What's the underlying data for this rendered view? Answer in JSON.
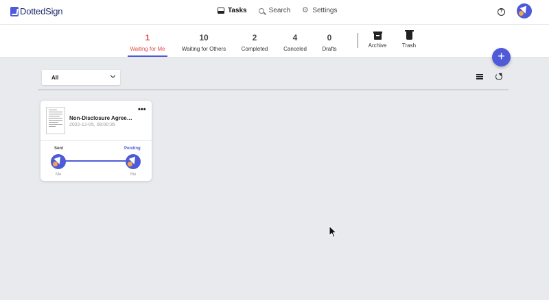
{
  "app": {
    "logo_text": "DottedSign"
  },
  "nav": {
    "items": [
      {
        "label": "Tasks",
        "icon": "tasks-icon",
        "active": true
      },
      {
        "label": "Search",
        "icon": "search-icon",
        "active": false
      },
      {
        "label": "Settings",
        "icon": "gear-icon",
        "active": false
      }
    ],
    "help_glyph": "?"
  },
  "tabs": [
    {
      "count": "1",
      "label": "Waiting for Me",
      "active": true
    },
    {
      "count": "10",
      "label": "Waiting for Others",
      "active": false
    },
    {
      "count": "2",
      "label": "Completed",
      "active": false
    },
    {
      "count": "4",
      "label": "Canceled",
      "active": false
    },
    {
      "count": "0",
      "label": "Drafts",
      "active": false
    }
  ],
  "folders": [
    {
      "label": "Archive",
      "icon": "archive-icon"
    },
    {
      "label": "Trash",
      "icon": "trash-icon"
    }
  ],
  "fab": {
    "label": "+"
  },
  "filter": {
    "selected": "All"
  },
  "card": {
    "title": "Non-Disclosure Agreement",
    "date": "2022-12-05, 09:00:35",
    "more": "•••",
    "sender_status": "Sent",
    "signer_status": "Pending",
    "sender_name": "Me",
    "signer_name": "Me"
  },
  "colors": {
    "accent": "#4e5ad8",
    "active_tab": "#e04a4a",
    "background": "#e9eaee"
  }
}
